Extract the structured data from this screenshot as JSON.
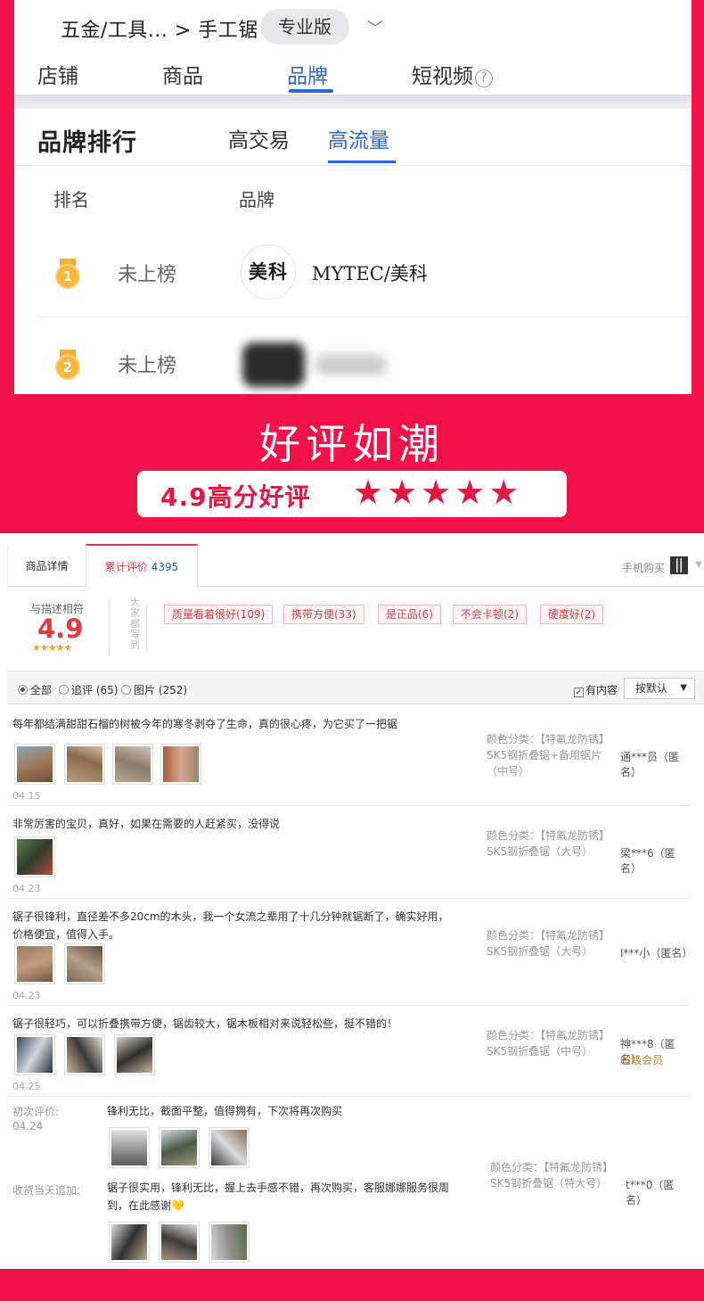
{
  "header": {
    "breadcrumb": "五金/工具... > 手工锯",
    "edition": "专业版",
    "tabs": [
      "店铺",
      "商品",
      "品牌",
      "短视频"
    ],
    "active_tab": "品牌"
  },
  "brand_rank": {
    "title": "品牌排行",
    "sub_tabs": [
      "高交易",
      "高流量"
    ],
    "active_sub_tab": "高流量",
    "col_rank": "排名",
    "col_brand": "品牌",
    "rows": [
      {
        "medal": "1",
        "status": "未上榜",
        "logo_text": "美科",
        "name": "MYTEC/美科"
      },
      {
        "medal": "2",
        "status": "未上榜",
        "logo_text": "",
        "name": ""
      }
    ]
  },
  "banner": {
    "title": "好评如潮",
    "score_text": "4.9高分好评",
    "stars": "★★★★★"
  },
  "reviews_panel": {
    "tab_detail": "商品详情",
    "tab_reviews": "累计评价",
    "review_count": "4395",
    "mobile_buy": "手机购买",
    "rate_label": "与描述相符",
    "rate_value": "4.9",
    "rate_stars": "★★★★★",
    "vertical_hint": "大家都写到",
    "tags": [
      "质量看着很好(109)",
      "携带方便(33)",
      "是正品(6)",
      "不会卡顿(2)",
      "硬度好(2)"
    ],
    "filters": {
      "all": "全部",
      "followup": "追评 (65)",
      "pictures": "图片 (252)",
      "has_content": "有内容",
      "sort": "按默认"
    },
    "items": [
      {
        "text": "每年都结满甜甜石榴的树被今年的寒冬剥夺了生命，真的很心疼，为它买了一把锯",
        "date": "04.15",
        "spec": "颜色分类：【特氟龙防锈】SK5钢折叠锯+备用锯片（中号）",
        "user": "通***员（匿名）"
      },
      {
        "text": "非常厉害的宝贝，真好，如果在需要的人赶紧买，没得说",
        "date": "04.23",
        "spec": "颜色分类：【特氟龙防锈】SK5钢折叠锯（大号）",
        "user": "梁***6（匿名）"
      },
      {
        "text": "锯子很锋利，直径差不多20cm的木头，我一个女流之辈用了十几分钟就锯断了，确实好用，价格便宜，值得入手。",
        "date": "04.23",
        "spec": "颜色分类：【特氟龙防锈】SK5钢折叠锯（大号）",
        "user": "l***小（匿名）"
      },
      {
        "text": "锯子很轻巧，可以折叠携带方便，锯齿较大，锯木板相对来说轻松些，挺不错的！",
        "date": "04.25",
        "spec": "颜色分类：【特氟龙防锈】SK5钢折叠锯（中号）",
        "user": "神***8（匿名）",
        "vip": "超级会员"
      }
    ],
    "last": {
      "first_label": "初次评价:",
      "first_date": "04.24",
      "first_text": "锋利无比，截面平整，值得拥有，下次将再次购买",
      "append_label": "收货当天追加:",
      "append_text": "锯子很实用，锋利无比，握上去手感不错，再次购买，客服娜娜服务很周到，在此感谢💛",
      "spec": "颜色分类：【特氟龙防锈】SK5钢折叠锯（特大号）",
      "user": "t***0（匿名）"
    }
  },
  "colors": {
    "accent_red": "#f2124a",
    "link_blue": "#2b66d9",
    "review_red": "#e4393c",
    "star_gold": "#f4a21b"
  }
}
